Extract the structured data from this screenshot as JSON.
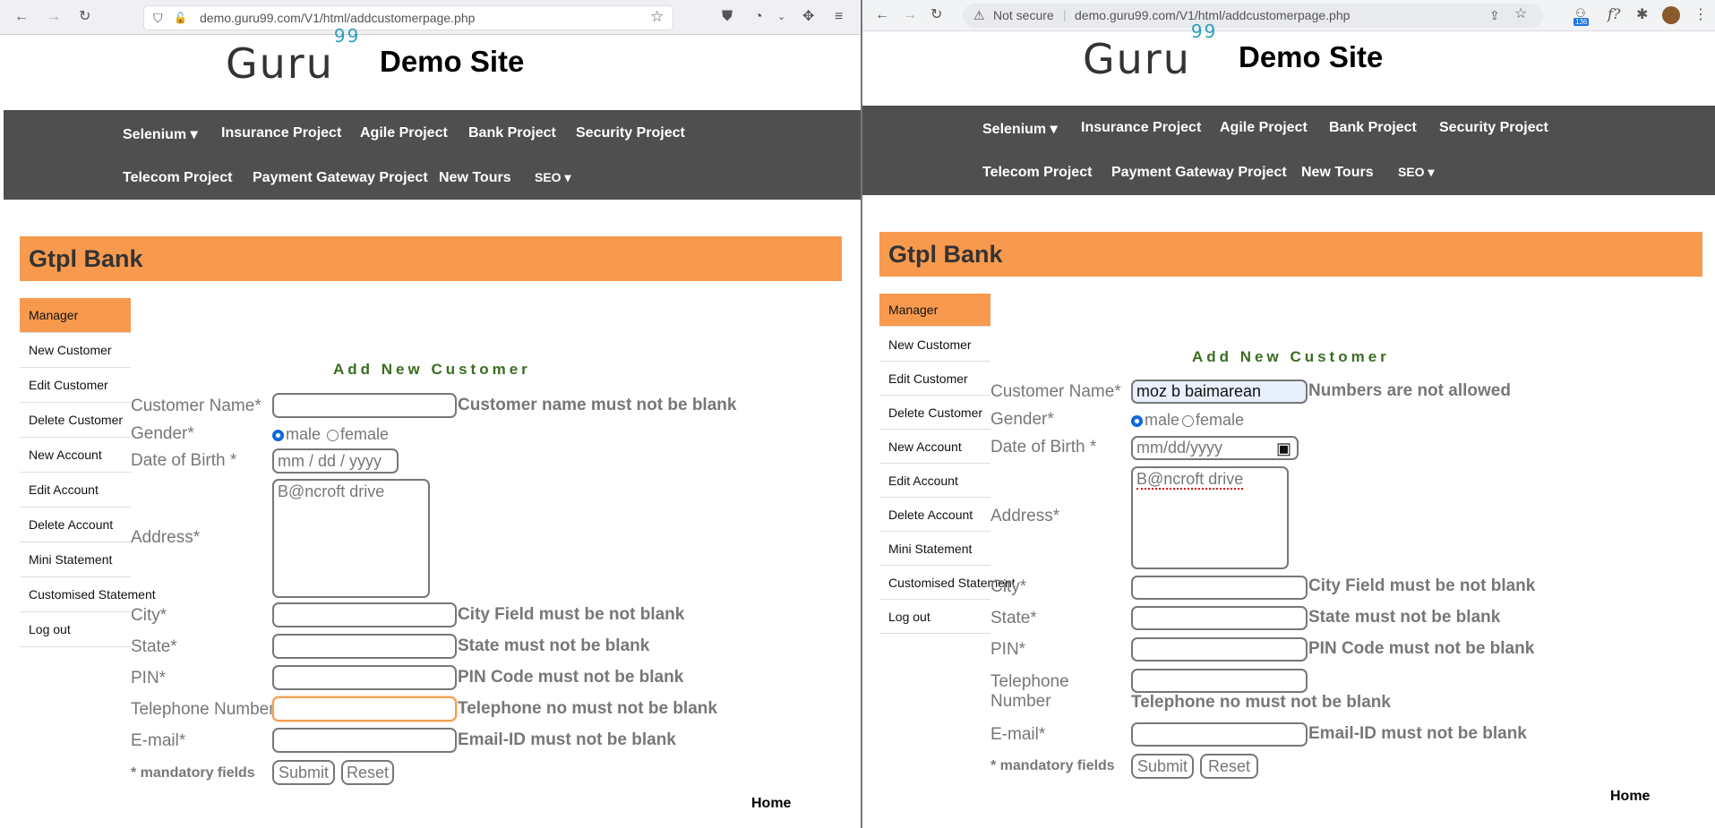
{
  "left_window": {
    "url": "demo.guru99.com/V1/html/addcustomerpage.php",
    "url_domain": "guru99.com",
    "customer_name_value": "",
    "dob_placeholder": "mm / dd / yyyy",
    "address_value": "B@ncroft drive",
    "error_customer_name": "Customer name must not be blank",
    "focused_field": "telephone"
  },
  "right_window": {
    "security_label": "Not secure",
    "url": "demo.guru99.com/V1/html/addcustomerpage.php",
    "url_domain": "guru99.com",
    "extension_badge": "136",
    "customer_name_value": "moz b baimarean",
    "dob_placeholder": "mm/dd/yyyy",
    "address_value": "B@ncroft drive",
    "error_customer_name": "Numbers are not allowed"
  },
  "site": {
    "logo_text": "Guru",
    "logo_sup": "99",
    "title": "Demo Site",
    "nav_row1": [
      "Selenium ▾",
      "Insurance Project",
      "Agile Project",
      "Bank Project",
      "Security Project"
    ],
    "nav_row2": [
      "Telecom Project",
      "Payment Gateway Project",
      "New Tours",
      "SEO ▾"
    ],
    "bank_title": "Gtpl Bank",
    "sidebar": [
      "Manager",
      "New Customer",
      "Edit Customer",
      "Delete Customer",
      "New Account",
      "Edit Account",
      "Delete Account",
      "Mini Statement",
      "Customised Statement",
      "Log out"
    ],
    "form_title": "Add New Customer",
    "labels": {
      "customer_name": "Customer Name*",
      "gender": "Gender*",
      "dob": "Date of Birth *",
      "address": "Address*",
      "city": "City*",
      "state": "State*",
      "pin": "PIN*",
      "telephone": "Telephone Number",
      "email": "E-mail*",
      "mandatory": "* mandatory fields"
    },
    "gender_options": [
      "male",
      "female"
    ],
    "gender_selected": "male",
    "errors": {
      "city": "City Field must be not blank",
      "state": "State must not be blank",
      "pin": "PIN Code must not be blank",
      "telephone": "Telephone no must not be blank",
      "email": "Email-ID must not be blank"
    },
    "submit_label": "Submit",
    "reset_label": "Reset",
    "home_link": "Home"
  },
  "colors": {
    "nav_bg": "#4f4f4f",
    "accent_orange": "#f89a4e",
    "form_title_green": "#3a6e20",
    "logo_blue": "#2b9fbd",
    "radio_blue": "#0a68d6"
  },
  "icons": [
    "back-arrow-icon",
    "forward-arrow-icon",
    "reload-icon",
    "shield-icon",
    "lock-icon",
    "star-icon",
    "pocket-icon",
    "menu-icon",
    "warning-icon",
    "share-icon",
    "puzzle-icon",
    "avatar-icon"
  ]
}
